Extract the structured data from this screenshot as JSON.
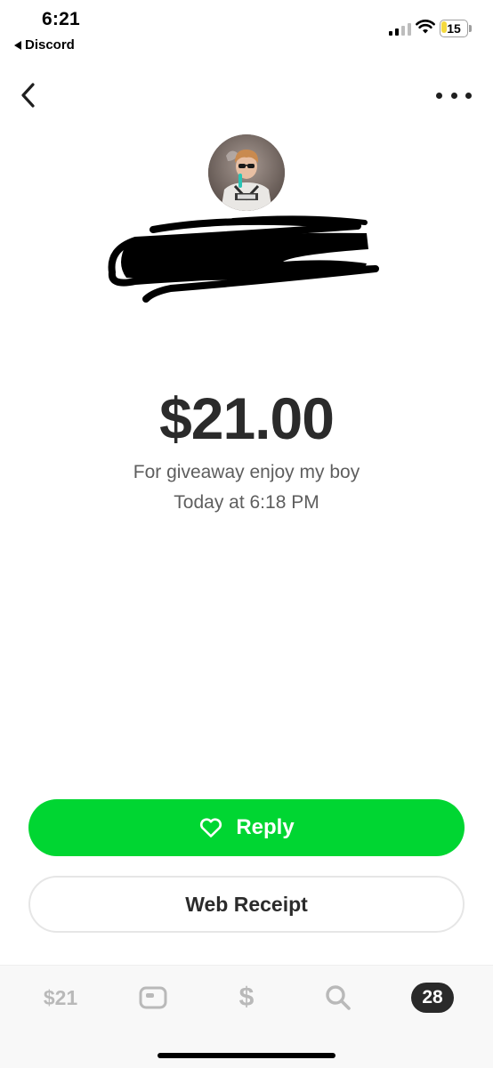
{
  "status_bar": {
    "time": "6:21",
    "back_app": "Discord",
    "battery": "15",
    "battery_level": 0.15,
    "signal_bars_filled": 2,
    "signal_bars_total": 4
  },
  "nav": {
    "back_icon": "chevron-left-icon",
    "more_icon": "more-horizontal-icon"
  },
  "payment": {
    "amount": "$21.00",
    "note": "For giveaway enjoy my boy",
    "time": "Today at 6:18 PM"
  },
  "actions": {
    "reply_label": "Reply",
    "reply_icon": "heart-icon",
    "receipt_label": "Web Receipt"
  },
  "tabbar": {
    "balance": "$21",
    "card_icon": "card-icon",
    "pay": "$",
    "search_icon": "search-icon",
    "activity_badge": "28"
  },
  "colors": {
    "accent": "#00d632",
    "text": "#2b2b2b",
    "muted": "#5e5e5e",
    "tab_inactive": "#b9b9b9",
    "battery": "#f4d93f"
  }
}
